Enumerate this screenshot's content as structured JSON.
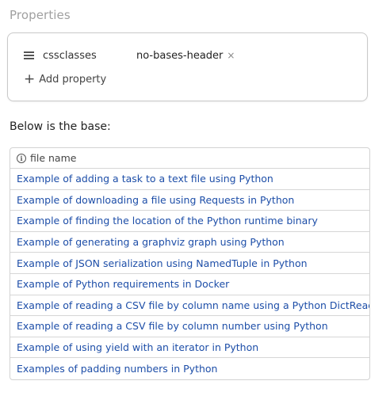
{
  "properties": {
    "heading": "Properties",
    "rows": [
      {
        "key": "cssclasses",
        "value": "no-bases-header",
        "remove": "×"
      }
    ],
    "add_label": "Add property",
    "add_symbol": "+"
  },
  "base": {
    "intro": "Below is the base:",
    "column_header": "file name",
    "rows": [
      "Example of adding a task to a text file using Python",
      "Example of downloading a file using Requests in Python",
      "Example of finding the location of the Python runtime binary",
      "Example of generating a graphviz graph using Python",
      "Example of JSON serialization using NamedTuple in Python",
      "Example of Python requirements in Docker",
      "Example of reading a CSV file by column name using a Python DictReader",
      "Example of reading a CSV file by column number using Python",
      "Example of using yield with an iterator in Python",
      "Examples of padding numbers in Python"
    ]
  },
  "colors": {
    "link": "#1d4ea8",
    "muted_heading": "#a0a0a0",
    "border": "#c9c9c9"
  }
}
